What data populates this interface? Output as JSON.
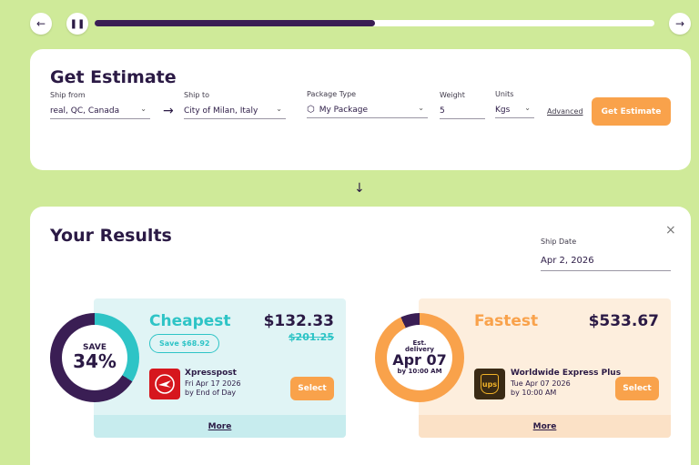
{
  "player": {
    "progress": 0.5
  },
  "estimate": {
    "title": "Get Estimate",
    "ship_from": {
      "label": "Ship from",
      "value": "real, QC, Canada"
    },
    "ship_to": {
      "label": "Ship to",
      "value": "City of Milan, Italy"
    },
    "package_type": {
      "label": "Package Type",
      "value": "My Package"
    },
    "weight": {
      "label": "Weight",
      "value": "5"
    },
    "units": {
      "label": "Units",
      "value": "Kgs"
    },
    "advanced_label": "Advanced",
    "button_label": "Get Estimate"
  },
  "results": {
    "title": "Your Results",
    "ship_date": {
      "label": "Ship Date",
      "value": "Apr 2, 2026"
    },
    "cheapest": {
      "tag": "Cheapest",
      "ring_top": "SAVE",
      "ring_big": "34%",
      "ring_fraction": 0.34,
      "price": "$132.33",
      "old_price": "$201.25",
      "save_badge": "Save $68.92",
      "service_name": "Xpresspost",
      "service_date": "Fri Apr 17 2026",
      "service_time": "by End of Day",
      "select_label": "Select",
      "more_label": "More",
      "accent": "#2ec4c6"
    },
    "fastest": {
      "tag": "Fastest",
      "ring_top": "Est. delivery",
      "ring_big": "Apr 07",
      "ring_bottom": "by 10:00 AM",
      "price": "$533.67",
      "service_name": "Worldwide Express Plus",
      "service_date": "Tue Apr 07 2026",
      "service_time": "by 10:00 AM",
      "logo_text": "ups",
      "select_label": "Select",
      "more_label": "More",
      "accent": "#f9a24b"
    }
  }
}
